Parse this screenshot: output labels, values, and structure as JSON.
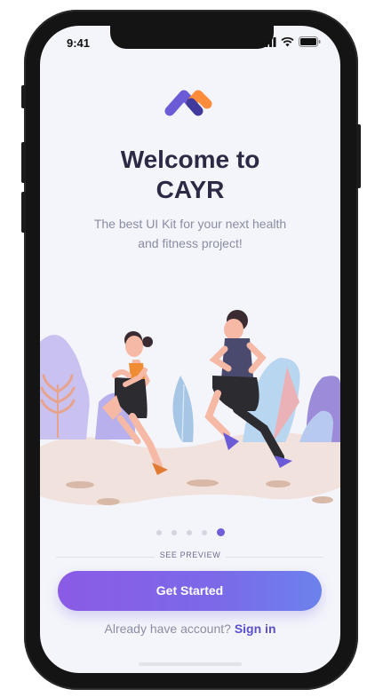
{
  "status_bar": {
    "time": "9:41"
  },
  "onboarding": {
    "title_line1": "Welcome to",
    "title_line2": "CAYR",
    "subtitle_line1": "The best UI Kit for your next health",
    "subtitle_line2": "and fitness project!",
    "page_indicator": {
      "total": 5,
      "current": 5
    }
  },
  "preview": {
    "label": "SEE PREVIEW"
  },
  "cta": {
    "label": "Get Started"
  },
  "signin": {
    "prompt": "Already have account?",
    "link_label": "Sign in"
  },
  "icons": [
    "cayr-logo-icon",
    "signal-icon",
    "wifi-icon",
    "battery-icon"
  ],
  "colors": {
    "accent": "#6d5fd8",
    "logo_primary": "#6b5bd6",
    "logo_secondary": "#ff8c3a",
    "text_dark": "#2c2b45",
    "text_muted": "#8a8da3",
    "background": "#f4f5fb"
  }
}
